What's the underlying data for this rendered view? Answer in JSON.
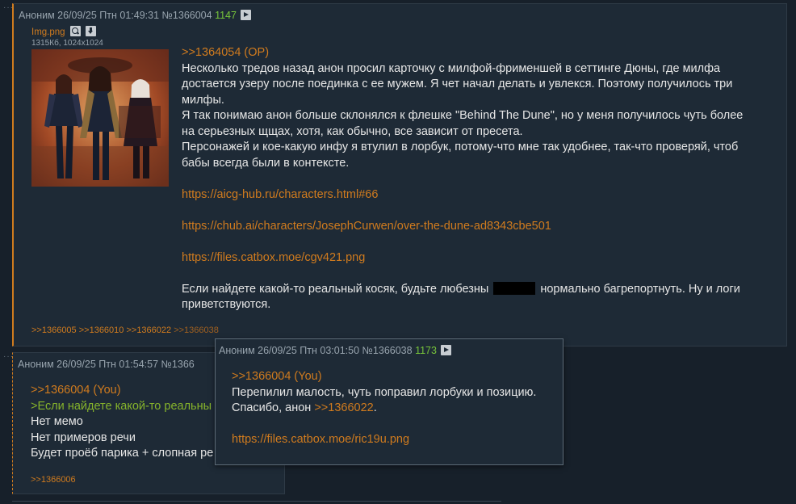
{
  "posts": [
    {
      "author": "Аноним",
      "datetime": "26/09/25 Птн 01:49:31",
      "number": "№1366004",
      "rating": "1147",
      "file": {
        "name": "Img.png",
        "meta": "1315Кб, 1024x1024"
      },
      "body": {
        "quote_ref": ">>1364054 (OP)",
        "lines": [
          "Несколько тредов назад анон просил карточку с милфой-фрименшей в сеттинге Дюны, где милфа",
          "достается узеру после поединка с ее мужем. Я чет начал делать и увлекся. Поэтому получилось три",
          "милфы.",
          "Я так понимаю анон больше склонялся к флешке \"Behind The Dune\", но у меня получилось чуть более",
          "на серьезных щщах, хотя, как обычно, все зависит от пресета.",
          "Персонажей и кое-какую инфу я втулил в лорбук, потому-что мне так удобнее, так-что проверяй, чтоб",
          "бабы всегда были в контексте."
        ],
        "links": [
          "https://aicg-hub.ru/characters.html#66",
          "https://chub.ai/characters/JosephCurwen/over-the-dune-ad8343cbe501",
          "https://files.catbox.moe/cgv421.png"
        ],
        "closing_a": "Если найдете какой-то реальный косяк, будьте любезны",
        "closing_b": "нормально багрепортнуть. Ну и логи",
        "closing_c": "приветствуются."
      },
      "replies": [
        ">>1366005",
        ">>1366010",
        ">>1366022",
        ">>1366038"
      ]
    },
    {
      "author": "Аноним",
      "datetime": "26/09/25 Птн 01:54:57",
      "number": "№1366",
      "body": {
        "quote_ref": ">>1366004 (You)",
        "greentext": ">Если найдете какой-то реальны",
        "lines": [
          "Нет мемо",
          "Нет примеров речи",
          "Будет проёб парика + слопная ре"
        ]
      },
      "replies": [
        ">>1366006"
      ]
    }
  ],
  "popup": {
    "author": "Аноним",
    "datetime": "26/09/25 Птн 03:01:50",
    "number": "№1366038",
    "rating": "1173",
    "body": {
      "quote_ref": ">>1366004 (You)",
      "line1": "Перепилил малость, чуть поправил лорбуки и позицию.",
      "line2_prefix": "Спасибо, анон ",
      "line2_ref": ">>1366022",
      "line2_suffix": ".",
      "link": "https://files.catbox.moe/ric19u.png"
    }
  },
  "colors": {
    "accent": "#d07b1e",
    "background": "#17202a",
    "post_bg": "#1e2a36",
    "greentext": "#86b42b",
    "rating": "#77c43a"
  }
}
